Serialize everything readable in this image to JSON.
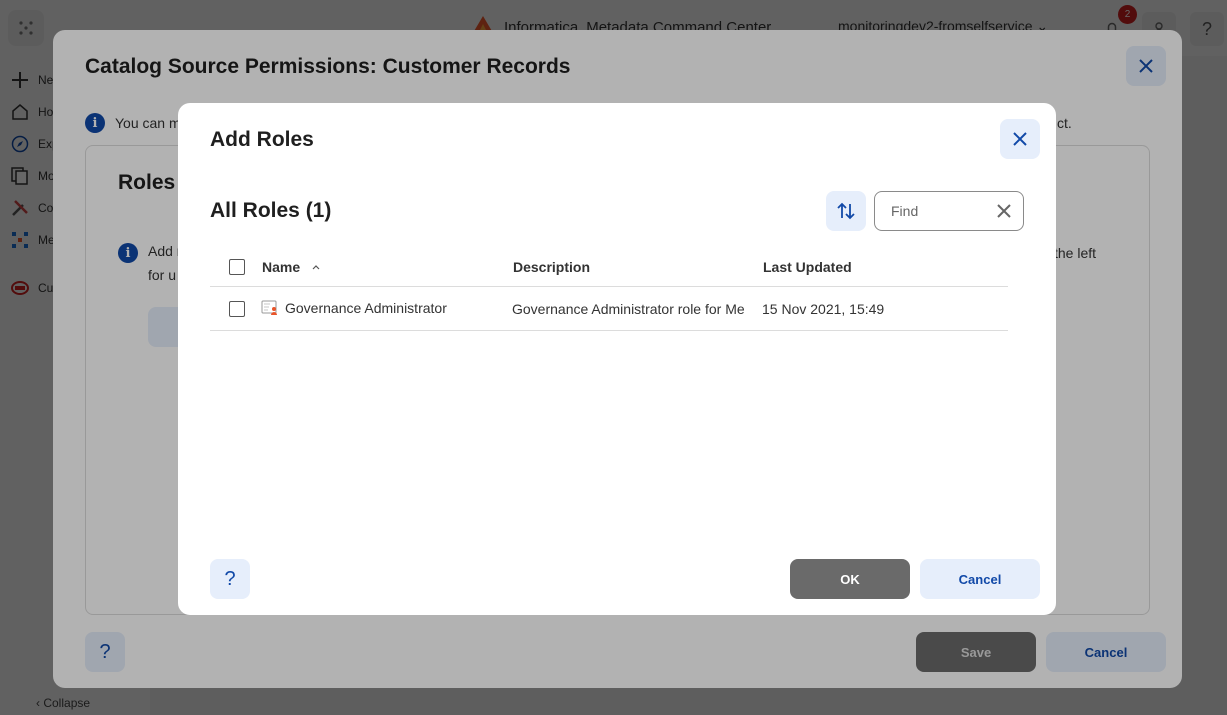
{
  "app": {
    "logo_text": "Informatica",
    "product_name": "Metadata Command Center",
    "org_name": "monitoringdev2-fromselfservice",
    "notification_count": "2",
    "help_label": "?",
    "sidebar": {
      "items": [
        {
          "label": "Ne",
          "icon": "plus-icon"
        },
        {
          "label": "Ho",
          "icon": "home-icon"
        },
        {
          "label": "Exp",
          "icon": "compass-icon"
        },
        {
          "label": "Mo",
          "icon": "documents-icon"
        },
        {
          "label": "Co",
          "icon": "tools-icon"
        },
        {
          "label": "Me",
          "icon": "network-icon"
        },
        {
          "label": "Cu",
          "icon": "database-icon"
        }
      ],
      "collapse_label": "Collapse"
    }
  },
  "outer_dialog": {
    "title": "Catalog Source Permissions: Customer Records",
    "info_text_start": "You can m",
    "info_text_end": "ct.",
    "panel_title": "Roles",
    "panel_info_start": "Add r",
    "panel_info_end": "the left",
    "panel_info_line2": "for u",
    "help_label": "?",
    "save_label": "Save",
    "cancel_label": "Cancel"
  },
  "dialog": {
    "title": "Add Roles",
    "subtitle": "All Roles (1)",
    "find_placeholder": "Find",
    "help_label": "?",
    "ok_label": "OK",
    "cancel_label": "Cancel",
    "columns": {
      "name": "Name",
      "description": "Description",
      "last_updated": "Last Updated"
    },
    "rows": [
      {
        "name": "Governance Administrator",
        "description": "Governance Administrator role for Me",
        "last_updated": "15 Nov 2021, 15:49"
      }
    ]
  },
  "colors": {
    "accent": "#1149a8",
    "button_light_bg": "#e6eefb",
    "primary_disabled": "#6a6a6a",
    "notification_badge": "#cc1f1f",
    "logo_orange": "#e8552b"
  }
}
